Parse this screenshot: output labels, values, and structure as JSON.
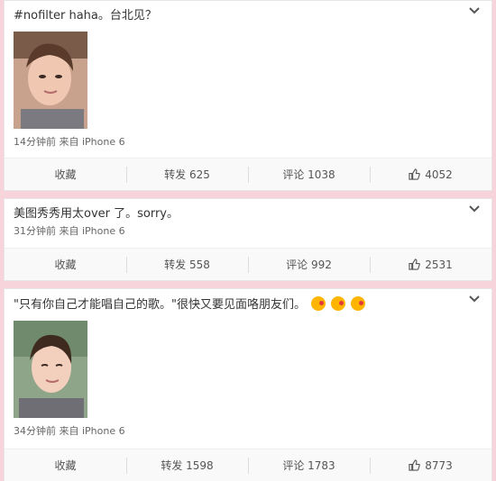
{
  "posts": [
    {
      "text": "#nofilter haha。台北见？",
      "meta": "14分钟前 来自 iPhone 6",
      "actions": {
        "favorite": "收藏",
        "repost": "转发 625",
        "comment": "评论 1038",
        "like": "4052"
      }
    },
    {
      "text": "美图秀秀用太over 了。sorry。",
      "meta": "31分钟前 来自 iPhone 6",
      "actions": {
        "favorite": "收藏",
        "repost": "转发 558",
        "comment": "评论 992",
        "like": "2531"
      }
    },
    {
      "text": "\"只有你自己才能唱自己的歌。\"很快又要见面咯朋友们。",
      "emojis": [
        "kiss-emoji",
        "kiss-emoji",
        "kiss-emoji"
      ],
      "meta": "34分钟前 来自 iPhone 6",
      "actions": {
        "favorite": "收藏",
        "repost": "转发 1598",
        "comment": "评论 1783",
        "like": "8773"
      }
    }
  ],
  "colors": {
    "background": "#f7d3dc",
    "card": "#ffffff",
    "action_bar": "#f9f9f9"
  },
  "icons": {
    "more": "chevron-down-icon",
    "like": "thumbs-up-icon"
  }
}
